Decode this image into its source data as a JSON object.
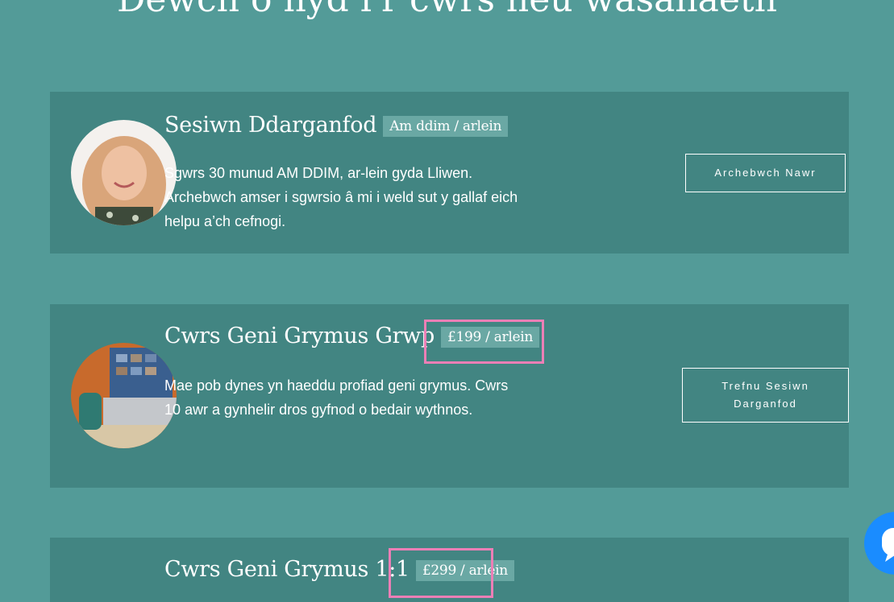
{
  "page": {
    "heading": "Dewch o hyd i'r cwrs neu wasanaeth"
  },
  "services": [
    {
      "title": "Sesiwn Ddarganfod",
      "badge": "Am ddim / arlein",
      "description": "Sgwrs 30 munud AM DDIM, ar-lein gyda Lliwen. Archebwch amser i sgwrsio â mi i weld sut y gallaf eich helpu a’ch cefnogi.",
      "button": "Archebwch Nawr"
    },
    {
      "title": "Cwrs Geni Grymus Grwp",
      "badge": "£199 / arlein",
      "description": "Mae pob dynes yn haeddu profiad geni grymus. Cwrs 10 awr a gynhelir dros gyfnod o bedair wythnos.",
      "button": "Trefnu Sesiwn Darganfod"
    },
    {
      "title": "Cwrs Geni Grymus 1:1",
      "badge": "£299 / arlein"
    }
  ],
  "colors": {
    "background": "#539b98",
    "card": "#428582",
    "badge": "#6aa8a4",
    "highlight": "#ec7fb6",
    "chat": "#1a8cff"
  },
  "icons": {
    "chat": "chat-bubble-icon"
  }
}
